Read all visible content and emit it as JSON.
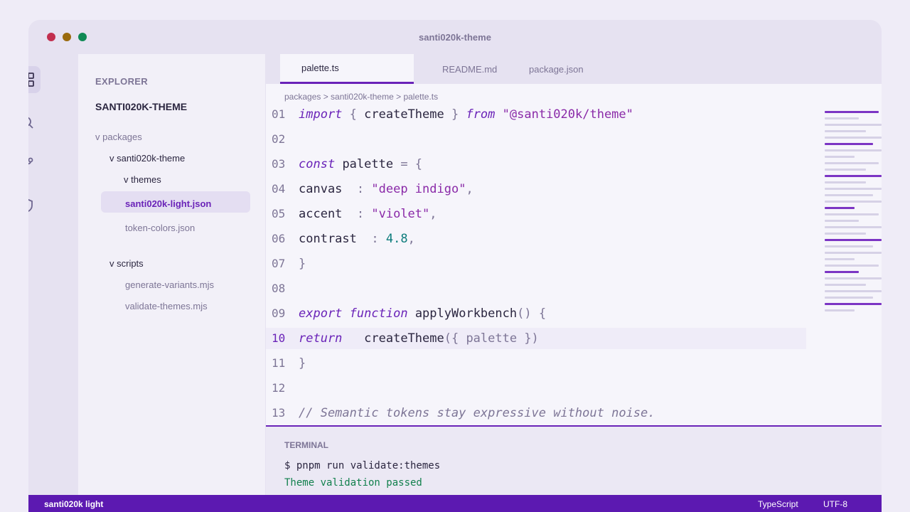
{
  "window": {
    "title": "santi020k-theme"
  },
  "activity_bar": {
    "items": [
      {
        "icon": "explorer-grid-icon",
        "active": true
      },
      {
        "icon": "search-icon",
        "active": false
      },
      {
        "icon": "source-control-icon",
        "active": false
      },
      {
        "icon": "shield-icon",
        "active": false
      }
    ]
  },
  "sidebar": {
    "heading": "EXPLORER",
    "project": "SANTI020K-THEME",
    "tree": [
      {
        "label": "v packages"
      },
      {
        "label": "v santi020k-theme"
      },
      {
        "label": "v themes"
      },
      {
        "label": "santi020k-light.json",
        "selected": true
      },
      {
        "label": "token-colors.json"
      },
      {
        "label": "v scripts"
      },
      {
        "label": "generate-variants.mjs"
      },
      {
        "label": "validate-themes.mjs"
      }
    ]
  },
  "tabs": [
    {
      "label": "palette.ts",
      "active": true
    },
    {
      "label": "README.md",
      "active": false
    },
    {
      "label": "package.json",
      "active": false
    }
  ],
  "breadcrumb": "packages > santi020k-theme > palette.ts",
  "code": {
    "current_line": "10",
    "lines": [
      {
        "n": "01",
        "t": [
          "import",
          " { ",
          "createTheme",
          " } ",
          "from",
          " ",
          "\"@santi020k/theme\""
        ]
      },
      {
        "n": "02",
        "t": []
      },
      {
        "n": "03",
        "t": [
          "const",
          " ",
          "palette",
          " = {"
        ]
      },
      {
        "n": "04",
        "t": [
          "canvas",
          "  : ",
          "\"deep indigo\"",
          ","
        ]
      },
      {
        "n": "05",
        "t": [
          "accent",
          "  : ",
          "\"violet\"",
          ","
        ]
      },
      {
        "n": "06",
        "t": [
          "contrast",
          "  : ",
          "4.8",
          ","
        ]
      },
      {
        "n": "07",
        "t": [
          "}"
        ]
      },
      {
        "n": "08",
        "t": []
      },
      {
        "n": "09",
        "t": [
          "export",
          " ",
          "function",
          " ",
          "applyWorkbench",
          "() {"
        ]
      },
      {
        "n": "10",
        "t": [
          "return",
          "   ",
          "createTheme",
          "({ palette })"
        ]
      },
      {
        "n": "11",
        "t": [
          "}"
        ]
      },
      {
        "n": "12",
        "t": []
      },
      {
        "n": "13",
        "t": [
          "// Semantic tokens stay expressive without noise."
        ]
      }
    ]
  },
  "terminal": {
    "title": "TERMINAL",
    "command": "$ pnpm run validate:themes",
    "output": "Theme validation passed"
  },
  "status_bar": {
    "theme": "santi020k light",
    "language": "TypeScript",
    "encoding": "UTF-8"
  },
  "colors": {
    "accent": "#6a23b8",
    "status_bar": "#5c19b1",
    "success": "#12804d"
  }
}
